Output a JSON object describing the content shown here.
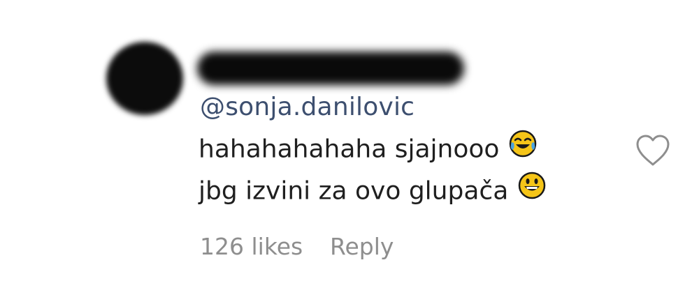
{
  "comment": {
    "mention": "@sonja.danilovic",
    "line1": "hahahahahaha sjajnooo",
    "line1_emoji": "face-with-tears-of-joy-icon",
    "line2": "jbg izvini za ovo glupača",
    "line2_emoji": "grinning-face-icon",
    "likes": "126 likes",
    "reply_label": "Reply"
  },
  "colors": {
    "mention": "#3d4f6f",
    "text": "#1f1f1f",
    "meta": "#8e8e8e",
    "emoji_yellow": "#f5c518"
  }
}
